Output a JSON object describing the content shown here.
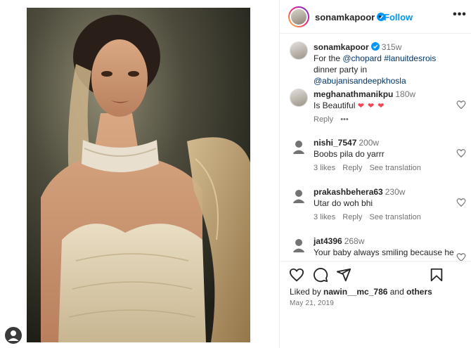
{
  "post_author": {
    "username": "sonamkapoor",
    "dot": "•",
    "follow_label": "Follow",
    "more_label": "•••"
  },
  "caption": {
    "username": "sonamkapoor",
    "time": "315w",
    "text_before": "For the ",
    "mention_1": "@chopard",
    "space": " ",
    "hashtag": "#lanuitdesrois",
    "text_mid": " dinner party in ",
    "mention_2": "@abujanisandeepkhosla"
  },
  "comments": [
    {
      "username": "meghanathmanikpu",
      "time": "180w",
      "text": "Is Beautiful",
      "emoji": "❤ ❤ ❤",
      "likes": "",
      "reply": "Reply",
      "more": "•••",
      "translate": ""
    },
    {
      "username": "nishi_7547",
      "time": "200w",
      "text": "Boobs pila do yarrr",
      "likes": "3 likes",
      "reply": "Reply",
      "translate": "See translation"
    },
    {
      "username": "prakashbehera63",
      "time": "230w",
      "text": "Utar do woh bhi",
      "likes": "3 likes",
      "reply": "Reply",
      "translate": "See translation"
    },
    {
      "username": "jat4396",
      "time": "268w",
      "text": "Your baby always smiling because he"
    }
  ],
  "likes_line": {
    "prefix": "Liked by ",
    "user": "nawin__mc_786",
    "middle": " and ",
    "others": "others"
  },
  "post_date": "May 21, 2019",
  "colors": {
    "accent": "#0095f6",
    "heart_red": "#ed4956",
    "muted": "#737373"
  }
}
